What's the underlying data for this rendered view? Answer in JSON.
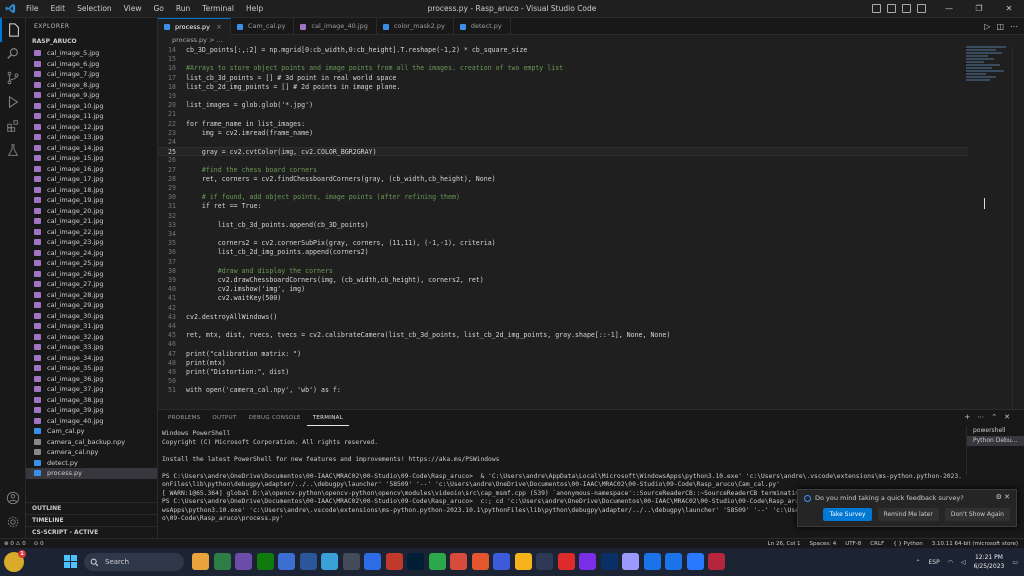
{
  "window": {
    "title": "process.py - Rasp_aruco - Visual Studio Code",
    "menu": [
      "File",
      "Edit",
      "Selection",
      "View",
      "Go",
      "Run",
      "Terminal",
      "Help"
    ],
    "controls": [
      "—",
      "❐",
      "✕"
    ]
  },
  "sidebar": {
    "header": "EXPLORER",
    "project": "RASP_ARUCO",
    "files": [
      {
        "name": "cal_image_5.jpg",
        "type": "img"
      },
      {
        "name": "cal_image_6.jpg",
        "type": "img"
      },
      {
        "name": "cal_image_7.jpg",
        "type": "img"
      },
      {
        "name": "cal_image_8.jpg",
        "type": "img"
      },
      {
        "name": "cal_image_9.jpg",
        "type": "img"
      },
      {
        "name": "cal_image_10.jpg",
        "type": "img"
      },
      {
        "name": "cal_image_11.jpg",
        "type": "img"
      },
      {
        "name": "cal_image_12.jpg",
        "type": "img"
      },
      {
        "name": "cal_image_13.jpg",
        "type": "img"
      },
      {
        "name": "cal_image_14.jpg",
        "type": "img"
      },
      {
        "name": "cal_image_15.jpg",
        "type": "img"
      },
      {
        "name": "cal_image_16.jpg",
        "type": "img"
      },
      {
        "name": "cal_image_17.jpg",
        "type": "img"
      },
      {
        "name": "cal_image_18.jpg",
        "type": "img"
      },
      {
        "name": "cal_image_19.jpg",
        "type": "img"
      },
      {
        "name": "cal_image_20.jpg",
        "type": "img"
      },
      {
        "name": "cal_image_21.jpg",
        "type": "img"
      },
      {
        "name": "cal_image_22.jpg",
        "type": "img"
      },
      {
        "name": "cal_image_23.jpg",
        "type": "img"
      },
      {
        "name": "cal_image_24.jpg",
        "type": "img"
      },
      {
        "name": "cal_image_25.jpg",
        "type": "img"
      },
      {
        "name": "cal_image_26.jpg",
        "type": "img"
      },
      {
        "name": "cal_image_27.jpg",
        "type": "img"
      },
      {
        "name": "cal_image_28.jpg",
        "type": "img"
      },
      {
        "name": "cal_image_29.jpg",
        "type": "img"
      },
      {
        "name": "cal_image_30.jpg",
        "type": "img"
      },
      {
        "name": "cal_image_31.jpg",
        "type": "img"
      },
      {
        "name": "cal_image_32.jpg",
        "type": "img"
      },
      {
        "name": "cal_image_33.jpg",
        "type": "img"
      },
      {
        "name": "cal_image_34.jpg",
        "type": "img"
      },
      {
        "name": "cal_image_35.jpg",
        "type": "img"
      },
      {
        "name": "cal_image_36.jpg",
        "type": "img"
      },
      {
        "name": "cal_image_37.jpg",
        "type": "img"
      },
      {
        "name": "cal_image_38.jpg",
        "type": "img"
      },
      {
        "name": "cal_image_39.jpg",
        "type": "img"
      },
      {
        "name": "cal_image_40.jpg",
        "type": "img"
      },
      {
        "name": "Cam_cal.py",
        "type": "py"
      },
      {
        "name": "camera_cal_backup.npy",
        "type": "npy"
      },
      {
        "name": "camera_cal.npy",
        "type": "npy"
      },
      {
        "name": "detect.py",
        "type": "py"
      },
      {
        "name": "process.py",
        "type": "py",
        "selected": true
      }
    ],
    "sections": [
      "OUTLINE",
      "TIMELINE",
      "CS-SCRIPT - ACTIVE"
    ]
  },
  "tabs": [
    {
      "label": "process.py",
      "active": true,
      "type": "py"
    },
    {
      "label": "Cam_cal.py",
      "type": "py"
    },
    {
      "label": "cal_image_40.jpg",
      "type": "img"
    },
    {
      "label": "color_mask2.py",
      "type": "py"
    },
    {
      "label": "detect.py",
      "type": "py"
    }
  ],
  "breadcrumb": "process.py > ...",
  "code": [
    {
      "n": "14",
      "t": "cb_3D_points[:,:2] = np.mgrid[0:cb_width,0:cb_height].T.reshape(-1,2) * cb_square_size"
    },
    {
      "n": "15",
      "t": ""
    },
    {
      "n": "16",
      "t": "#Arrays to store object points and image points from all the images. creation of two empty list"
    },
    {
      "n": "17",
      "t": "list_cb_3d_points = [] # 3d point in real world space"
    },
    {
      "n": "18",
      "t": "list_cb_2d_img_points = [] # 2d points in image plane."
    },
    {
      "n": "19",
      "t": ""
    },
    {
      "n": "20",
      "t": "list_images = glob.glob('*.jpg')"
    },
    {
      "n": "21",
      "t": ""
    },
    {
      "n": "22",
      "t": "for frame_name in list_images:"
    },
    {
      "n": "23",
      "t": "    img = cv2.imread(frame_name)"
    },
    {
      "n": "24",
      "t": ""
    },
    {
      "n": "25",
      "t": "    gray = cv2.cvtColor(img, cv2.COLOR_BGR2GRAY)",
      "current": true
    },
    {
      "n": "26",
      "t": ""
    },
    {
      "n": "27",
      "t": "    #find the chess board corners"
    },
    {
      "n": "28",
      "t": "    ret, corners = cv2.findChessboardCorners(gray, (cb_width,cb_height), None)"
    },
    {
      "n": "29",
      "t": ""
    },
    {
      "n": "30",
      "t": "    # if found, add object points, image points (after refining them)"
    },
    {
      "n": "31",
      "t": "    if ret == True:"
    },
    {
      "n": "32",
      "t": ""
    },
    {
      "n": "33",
      "t": "        list_cb_3d_points.append(cb_3D_points)"
    },
    {
      "n": "34",
      "t": ""
    },
    {
      "n": "35",
      "t": "        corners2 = cv2.cornerSubPix(gray, corners, (11,11), (-1,-1), criteria)"
    },
    {
      "n": "36",
      "t": "        list_cb_2d_img_points.append(corners2)"
    },
    {
      "n": "37",
      "t": ""
    },
    {
      "n": "38",
      "t": "        #draw and display the corners"
    },
    {
      "n": "39",
      "t": "        cv2.drawChessboardCorners(img, (cb_width,cb_height), corners2, ret)"
    },
    {
      "n": "40",
      "t": "        cv2.imshow('img', img)"
    },
    {
      "n": "41",
      "t": "        cv2.waitKey(500)"
    },
    {
      "n": "42",
      "t": ""
    },
    {
      "n": "43",
      "t": "cv2.destroyAllWindows()"
    },
    {
      "n": "44",
      "t": ""
    },
    {
      "n": "45",
      "t": "ret, mtx, dist, rvecs, tvecs = cv2.calibrateCamera(list_cb_3d_points, list_cb_2d_img_points, gray.shape[::-1], None, None)"
    },
    {
      "n": "46",
      "t": ""
    },
    {
      "n": "47",
      "t": "print(\"calibration matrix: \")"
    },
    {
      "n": "48",
      "t": "print(mtx)"
    },
    {
      "n": "49",
      "t": "print(\"Distortion:\", dist)"
    },
    {
      "n": "50",
      "t": ""
    },
    {
      "n": "51",
      "t": "with open('camera_cal.npy', 'wb') as f:"
    }
  ],
  "panel": {
    "tabs": [
      "PROBLEMS",
      "OUTPUT",
      "DEBUG CONSOLE",
      "TERMINAL"
    ],
    "active_tab": "TERMINAL",
    "terminal_lines": [
      "Windows PowerShell",
      "Copyright (C) Microsoft Corporation. All rights reserved.",
      "",
      "Install the latest PowerShell for new features and improvements! https://aka.ms/PSWindows",
      "",
      "PS C:\\Users\\andre\\OneDrive\\Documentos\\00-IAAC\\MRAC02\\00-Studio\\09-Code\\Rasp_aruco>  & 'C:\\Users\\andre\\AppData\\Local\\Microsoft\\WindowsApps\\python3.10.exe' 'c:\\Users\\andre\\.vscode\\extensions\\ms-python.python-2023.10.1\\pyth",
      "onFiles\\lib\\python\\debugpy\\adapter/../..\\debugpy\\launcher' '58509' '--' 'c:\\Users\\andre\\OneDrive\\Documentos\\00-IAAC\\MRAC02\\00-Studio\\09-Code\\Rasp_aruco\\Cam_cal.py'",
      "[ WARN:1@65.364] global D:\\a\\opencv-python\\opencv-python\\opencv\\modules\\videoio\\src\\cap_msmf.cpp (539) `anonymous-namespace'::SourceReaderCB::~SourceReaderCB terminating async",
      "PS C:\\Users\\andre\\OneDrive\\Documentos\\00-IAAC\\MRAC02\\00-Studio\\09-Code\\Rasp_aruco>  c:; cd 'c:\\Users\\andre\\OneDrive\\Documentos\\00-IAAC\\MRAC02\\00-Studio\\09-Code\\Rasp_aruco'; &",
      "wsApps\\python3.10.exe' 'c:\\Users\\andre\\.vscode\\extensions\\ms-python.python-2023.10.1\\pythonFiles\\lib\\python\\debugpy\\adapter/../..\\debugpy\\launcher' '58509' '--' 'c:\\Users\\and",
      "o\\09-Code\\Rasp_aruco\\process.py'"
    ],
    "terminals": [
      "powershell",
      "Python Debu..."
    ]
  },
  "notification": {
    "message": "Do you mind taking a quick feedback survey?",
    "buttons": [
      "Take Survey",
      "Remind Me later",
      "Don't Show Again"
    ]
  },
  "status": {
    "left": [
      "⊗ 0 ⚠ 0",
      "⊙ 0"
    ],
    "right": [
      "Ln 26, Col 1",
      "Spaces: 4",
      "UTF-8",
      "CRLF",
      "{ } Python",
      "3.10.11 64-bit (microsoft store)"
    ]
  },
  "taskbar": {
    "search_placeholder": "Search",
    "badge": "1",
    "lang": "ESP",
    "time": "12:21 PM",
    "date": "6/25/2023",
    "app_colors": [
      "#e8a33d",
      "#2d7d46",
      "#6b4ca8",
      "#0f7b0f",
      "#3c6fd1",
      "#2b579a",
      "#3aa0d8",
      "#444b5a",
      "#2e6be6",
      "#c0392b",
      "#001e36",
      "#2ba84a",
      "#d64b3b",
      "#e4572e",
      "#3b5bdb",
      "#f5b21a",
      "#2e3a55",
      "#dd2b2b",
      "#7a2ee6",
      "#0a2f66",
      "#9999ff",
      "#1a73e8",
      "#1a73e8",
      "#2979ff",
      "#b5253d"
    ]
  }
}
